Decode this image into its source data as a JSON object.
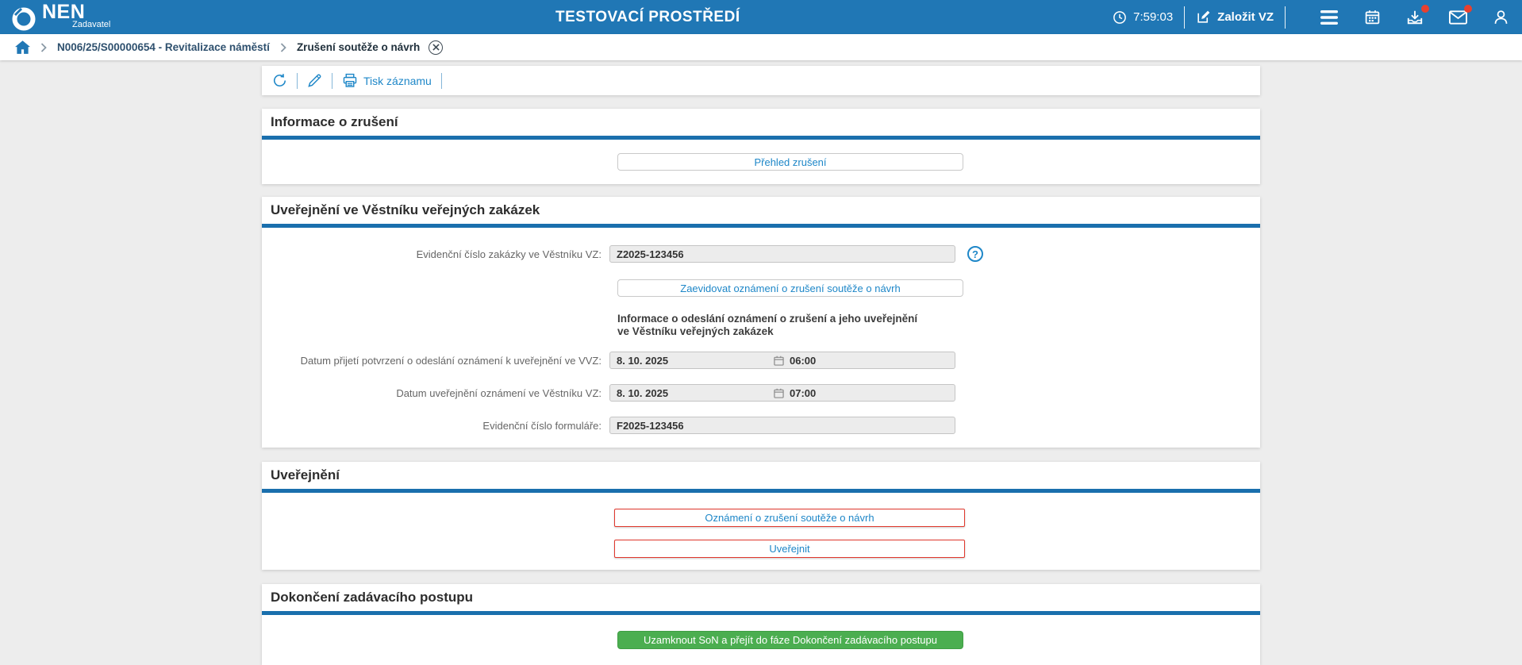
{
  "header": {
    "logo": {
      "text": "NEN",
      "subtext": "Zadavatel"
    },
    "environment_title": "TESTOVACÍ PROSTŘEDÍ",
    "clock_time": "7:59:03",
    "create_vz_label": "Založit VZ"
  },
  "breadcrumb": {
    "procurement": "N006/25/S00000654 - Revitalizace náměstí",
    "current": "Zrušení soutěže o návrh"
  },
  "toolbar": {
    "print_label": "Tisk záznamu"
  },
  "sections": {
    "cancellation_info": {
      "title": "Informace o zrušení",
      "overview_button": "Přehled zrušení"
    },
    "vvz_publication": {
      "title": "Uveřejnění ve Věstníku veřejných zakázek",
      "evidence_number_label": "Evidenční číslo zakázky ve Věstníku VZ:",
      "evidence_number_value": "Z2025-123456",
      "register_button": "Zaevidovat oznámení o zrušení soutěže o návrh",
      "info_text_line1": "Informace o odeslání oznámení o zrušení a jeho uveřejnění",
      "info_text_line2": "ve Věstníku veřejných zakázek",
      "confirmation_date_label": "Datum přijetí potvrzení o odeslání oznámení k uveřejnění ve VVZ:",
      "confirmation_date_value": "8. 10. 2025",
      "confirmation_time_value": "06:00",
      "publication_date_label": "Datum uveřejnění oznámení ve Věstníku VZ:",
      "publication_date_value": "8. 10. 2025",
      "publication_time_value": "07:00",
      "form_number_label": "Evidenční číslo formuláře:",
      "form_number_value": "F2025-123456",
      "help_glyph": "?"
    },
    "publication": {
      "title": "Uveřejnění",
      "notice_button": "Oznámení o zrušení soutěže o návrh",
      "publish_button": "Uveřejnit"
    },
    "completion": {
      "title": "Dokončení zadávacího postupu",
      "lock_button": "Uzamknout SoN a přejít do fáze Dokončení zadávacího postupu"
    }
  },
  "colors": {
    "header_blue": "#2077b5",
    "accent_blue": "#1e87c8",
    "section_underline": "#1a6fad",
    "alert_red": "#e0382d",
    "success_green": "#4bae50",
    "notification_red": "#e8402f"
  }
}
